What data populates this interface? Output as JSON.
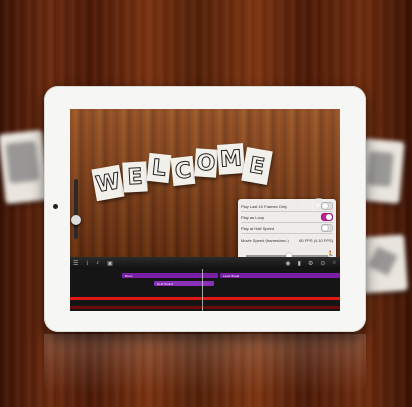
{
  "video": {
    "sign_letters": [
      "W",
      "E",
      "L",
      "C",
      "O",
      "M",
      "E"
    ]
  },
  "controls": {
    "play_icon": "play-icon"
  },
  "settings_panel": {
    "rows": [
      {
        "label": "Play Last 10 Frames Only",
        "toggle": "off"
      },
      {
        "label": "Play as Loop",
        "toggle": "on"
      },
      {
        "label": "Play at Half Speed",
        "toggle": "off"
      },
      {
        "label": "Movie Speed (frames/sec.)",
        "value": "60 FPS (4.10 FPS)"
      }
    ],
    "speed_level": 0.5
  },
  "toolbar": {
    "left_icons": [
      "menu-icon",
      "info-icon",
      "music-note-icon",
      "clapper-icon"
    ],
    "right_icons": [
      "audio-icon",
      "frame-icon",
      "settings-icon",
      "toggle-icon",
      "close-icon"
    ]
  },
  "timeline": {
    "tracks": [
      {
        "label": "Drum",
        "color": "#7a1fa8"
      },
      {
        "label": "Laser Break",
        "color": "#7a1fa8"
      },
      {
        "label": "Hi-Fi Sound",
        "color": "#8a2fb8"
      }
    ],
    "record_color": "#e01818"
  }
}
